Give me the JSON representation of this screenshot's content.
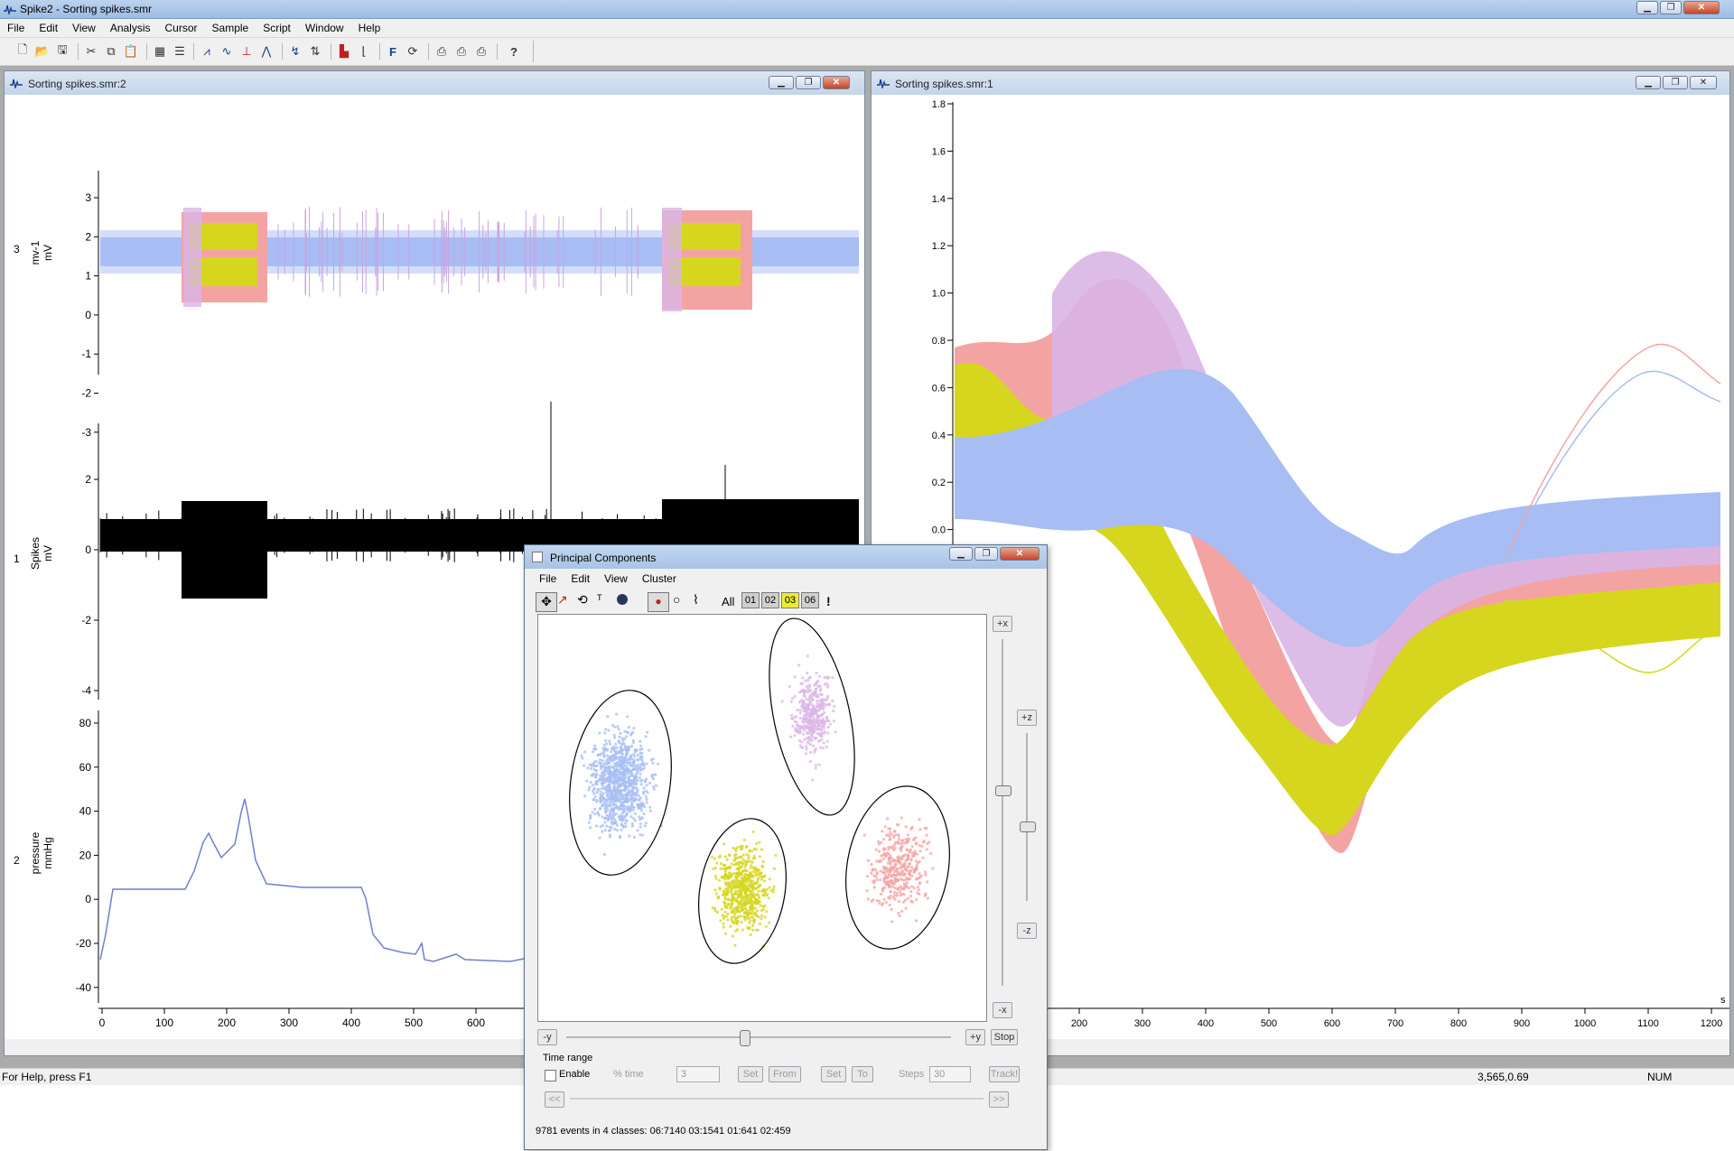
{
  "app": {
    "title": "Spike2 - Sorting spikes.smr",
    "menu": [
      "File",
      "Edit",
      "View",
      "Analysis",
      "Cursor",
      "Sample",
      "Script",
      "Window",
      "Help"
    ]
  },
  "toolbar_icons": [
    "new-file-icon",
    "open-folder-icon",
    "save-icon",
    "cut-icon",
    "copy-icon",
    "paste-icon",
    "new-window-icon",
    "settings-icon",
    "waveform-icon",
    "wave-icon",
    "trigger-icon",
    "event-icon",
    "cursor-icon",
    "measure-icon",
    "histogram-icon",
    "xy-icon",
    "font-icon",
    "script-icon",
    "print-icon",
    "print-visible-icon",
    "print-screen-icon",
    "help-icon"
  ],
  "left_window": {
    "title": "Sorting spikes.smr:2",
    "channels": [
      {
        "number": "3",
        "name": "mv-1",
        "unit": "mV",
        "yticks": [
          "3",
          "2",
          "1",
          "0",
          "-1",
          "-2",
          "-3"
        ]
      },
      {
        "number": "1",
        "name": "Spikes",
        "unit": "mV",
        "yticks": [
          "2",
          "0",
          "-2",
          "-4"
        ]
      },
      {
        "number": "2",
        "name": "pressure",
        "unit": "mmHg",
        "yticks": [
          "80",
          "60",
          "40",
          "20",
          "0",
          "-20",
          "-40"
        ]
      }
    ],
    "xticks": [
      "0",
      "100",
      "200",
      "300",
      "400",
      "500",
      "600"
    ]
  },
  "right_window": {
    "title": "Sorting spikes.smr:1",
    "yticks": [
      "1.8",
      "1.6",
      "1.4",
      "1.2",
      "1.0",
      "0.8",
      "0.6",
      "0.4",
      "0.2",
      "0.0"
    ],
    "xticks": [
      "200",
      "300",
      "400",
      "500",
      "600",
      "700",
      "800",
      "900",
      "1000",
      "1100",
      "1200"
    ],
    "xunit": "s"
  },
  "pca": {
    "title": "Principal Components",
    "menu": [
      "File",
      "Edit",
      "View",
      "Cluster"
    ],
    "all_label": "All",
    "classes": [
      "01",
      "02",
      "03",
      "06"
    ],
    "exclaim": "!",
    "axis_buttons": {
      "plus_x": "+x",
      "plus_z": "+z",
      "minus_z": "-z",
      "minus_x": "-x",
      "minus_y": "-y",
      "plus_y": "+y"
    },
    "stop_label": "Stop",
    "time_range_label": "Time range",
    "enable_label": "Enable",
    "pct_time_label": "% time",
    "value_3": "3",
    "set_label": "Set",
    "from_label": "From",
    "set2_label": "Set",
    "to_label": "To",
    "steps_label": "Steps",
    "steps_value": "30",
    "track_label": "Track!",
    "prev_label": "<<",
    "next_label": ">>",
    "status_text": "9781 events in 4 classes: 06:7140 03:1541 01:641 02:459",
    "colors": {
      "class06": "#a7bdf4",
      "class03": "#d6d61e",
      "class01": "#f4a3a3",
      "class02": "#d9b5e6"
    }
  },
  "status": {
    "help": "For Help, press F1",
    "coords": "3,565,0.69",
    "num": "NUM"
  }
}
